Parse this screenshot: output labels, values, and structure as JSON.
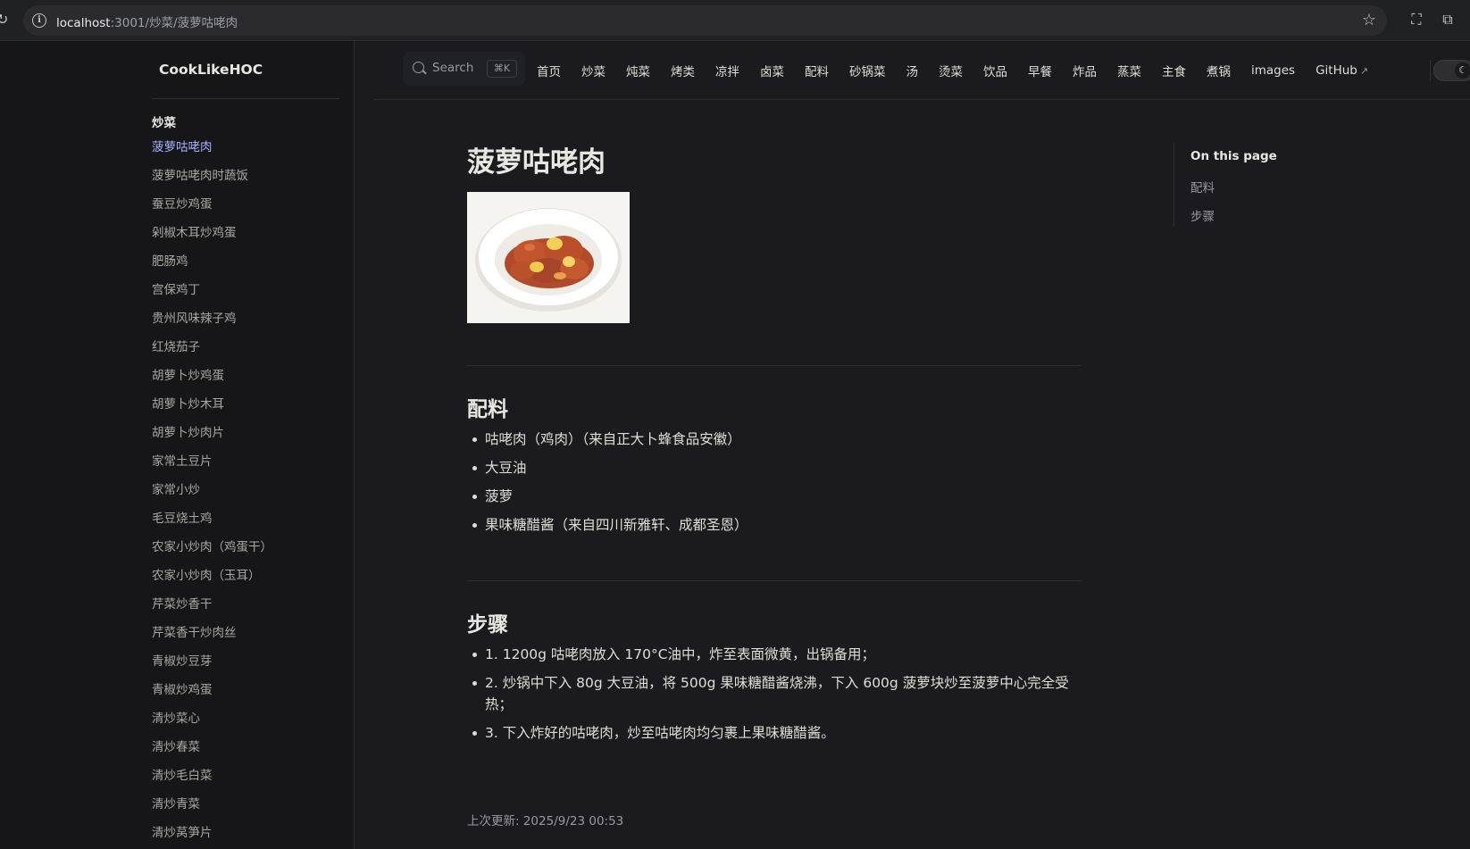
{
  "browser": {
    "url_host": "localhost",
    "url_path": ":3001/炒菜/菠萝咕咾肉"
  },
  "sidebar": {
    "brand": "CookLikeHOC",
    "group_title": "炒菜",
    "items": [
      "菠萝咕咾肉",
      "菠萝咕咾肉时蔬饭",
      "蚕豆炒鸡蛋",
      "剁椒木耳炒鸡蛋",
      "肥肠鸡",
      "宫保鸡丁",
      "贵州风味辣子鸡",
      "红烧茄子",
      "胡萝卜炒鸡蛋",
      "胡萝卜炒木耳",
      "胡萝卜炒肉片",
      "家常土豆片",
      "家常小炒",
      "毛豆烧土鸡",
      "农家小炒肉（鸡蛋干）",
      "农家小炒肉（玉耳）",
      "芹菜炒香干",
      "芹菜香干炒肉丝",
      "青椒炒豆芽",
      "青椒炒鸡蛋",
      "清炒菜心",
      "清炒春菜",
      "清炒毛白菜",
      "清炒青菜",
      "清炒莴笋片"
    ],
    "active_index": 0
  },
  "nav": {
    "search_label": "Search",
    "search_shortcut": "⌘K",
    "links": [
      "首页",
      "炒菜",
      "炖菜",
      "烤类",
      "凉拌",
      "卤菜",
      "配料",
      "砂锅菜",
      "汤",
      "烫菜",
      "饮品",
      "早餐",
      "炸品",
      "蒸菜",
      "主食",
      "煮锅",
      "images",
      "GitHub"
    ]
  },
  "page": {
    "title": "菠萝咕咾肉",
    "ingredients_heading": "配料",
    "ingredients": [
      "咕咾肉（鸡肉）（来自正大卜蜂食品安徽）",
      "大豆油",
      "菠萝",
      "果味糖醋酱（来自四川新雅轩、成都圣恩）"
    ],
    "steps_heading": "步骤",
    "steps": [
      "1. 1200g 咕咾肉放入 170°C油中，炸至表面微黄，出锅备用；",
      "2. 炒锅中下入 80g 大豆油，将 500g 果味糖醋酱烧沸，下入 600g 菠萝块炒至菠萝中心完全受热；",
      "3. 下入炸好的咕咾肉，炒至咕咾肉均匀裹上果味糖醋酱。"
    ],
    "last_updated": "上次更新: 2025/9/23 00:53"
  },
  "outline": {
    "title": "On this page",
    "links": [
      "配料",
      "步骤"
    ]
  },
  "colors": {
    "accent": "#a8b1ff",
    "background": "#1b1b1f",
    "sidebar_bg": "#161618"
  }
}
